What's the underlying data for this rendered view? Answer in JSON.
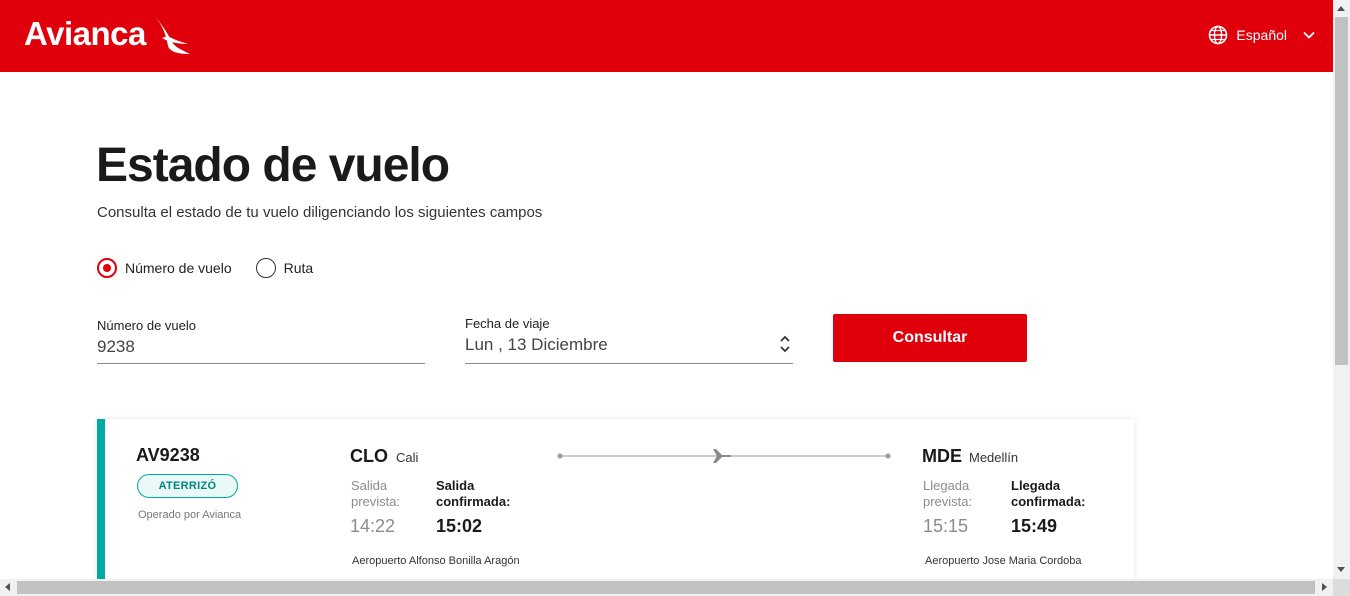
{
  "header": {
    "logo_text": "Avianca",
    "language_label": "Español",
    "brand_color": "#e0000b",
    "icons": {
      "globe": "globe-icon",
      "chevron": "chevron-down-icon"
    }
  },
  "main": {
    "title": "Estado de vuelo",
    "subtitle": "Consulta el estado de tu vuelo diligenciando los siguientes campos",
    "search_modes": [
      {
        "label": "Número de vuelo",
        "selected": true
      },
      {
        "label": "Ruta",
        "selected": false
      }
    ],
    "flight_number": {
      "label": "Número de vuelo",
      "value": "9238"
    },
    "travel_date": {
      "label": "Fecha de viaje",
      "value": "Lun , 13 Diciembre"
    },
    "submit_label": "Consultar"
  },
  "result": {
    "flight_code": "AV9238",
    "status": "ATERRIZÓ",
    "status_color": "#00a9a4",
    "operator": "Operado por Avianca",
    "origin": {
      "iata": "CLO",
      "city": "Cali",
      "scheduled_label": "Salida prevista:",
      "scheduled_time": "14:22",
      "confirmed_label": "Salida confirmada:",
      "confirmed_time": "15:02",
      "airport": "Aeropuerto Alfonso Bonilla Aragón"
    },
    "destination": {
      "iata": "MDE",
      "city": "Medellín",
      "scheduled_label": "Llegada prevista:",
      "scheduled_time": "15:15",
      "confirmed_label": "Llegada confirmada:",
      "confirmed_time": "15:49",
      "airport": "Aeropuerto Jose Maria Cordoba"
    }
  }
}
